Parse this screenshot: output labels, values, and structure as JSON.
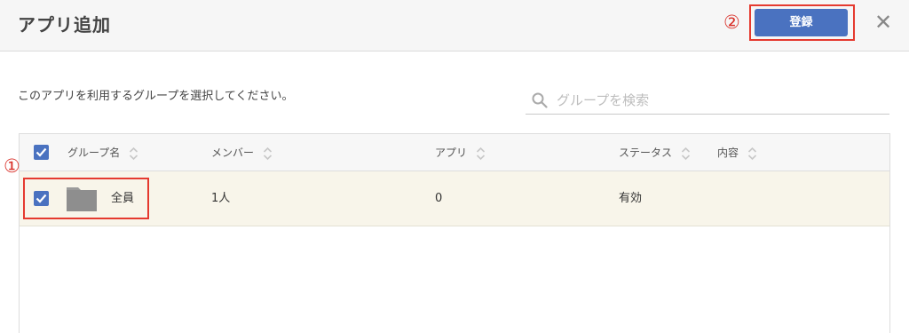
{
  "header": {
    "title": "アプリ追加",
    "register_label": "登録",
    "close_symbol": "✕"
  },
  "annotations": {
    "step1": "①",
    "step2": "②"
  },
  "description": "このアプリを利用するグループを選択してください。",
  "search": {
    "placeholder": "グループを検索"
  },
  "table": {
    "columns": [
      "グループ名",
      "メンバー",
      "アプリ",
      "ステータス",
      "内容"
    ],
    "rows": [
      {
        "checked": true,
        "group_name": "全員",
        "members": "1人",
        "apps": "0",
        "status": "有効",
        "content": ""
      }
    ],
    "header_checked": true
  },
  "colors": {
    "accent": "#4a72c0",
    "highlight": "#e53a2f",
    "row_selected_bg": "#f8f5ea"
  },
  "icons": [
    "search-icon",
    "close-icon",
    "folder-icon",
    "sort-icon",
    "check-icon"
  ]
}
